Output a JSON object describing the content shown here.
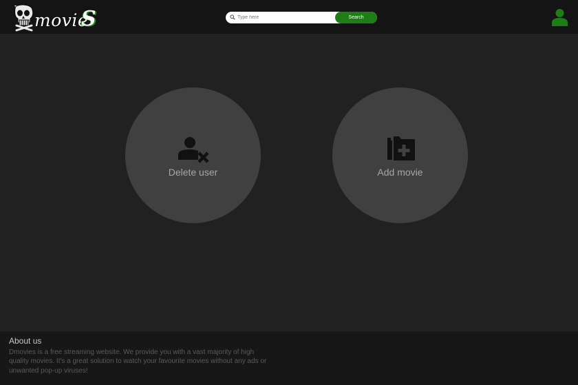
{
  "header": {
    "logo": {
      "text": "movie",
      "s_letter": "S"
    },
    "search": {
      "placeholder": "Type here",
      "button_label": "Search"
    }
  },
  "actions": [
    {
      "label": "Delete user",
      "icon": "remove-user-icon"
    },
    {
      "label": "Add movie",
      "icon": "add-folder-icon"
    }
  ],
  "footer": {
    "title": "About us",
    "text": "Dmovies is a free streaming website. We provide you with a vast majority of high quality movies. It's a great solution to watch your favourite movies without any ads or unwanted pop-up viruses!"
  },
  "colors": {
    "accent": "#1e7d14",
    "background": "#212121",
    "header": "#141414",
    "circle": "#404040"
  }
}
